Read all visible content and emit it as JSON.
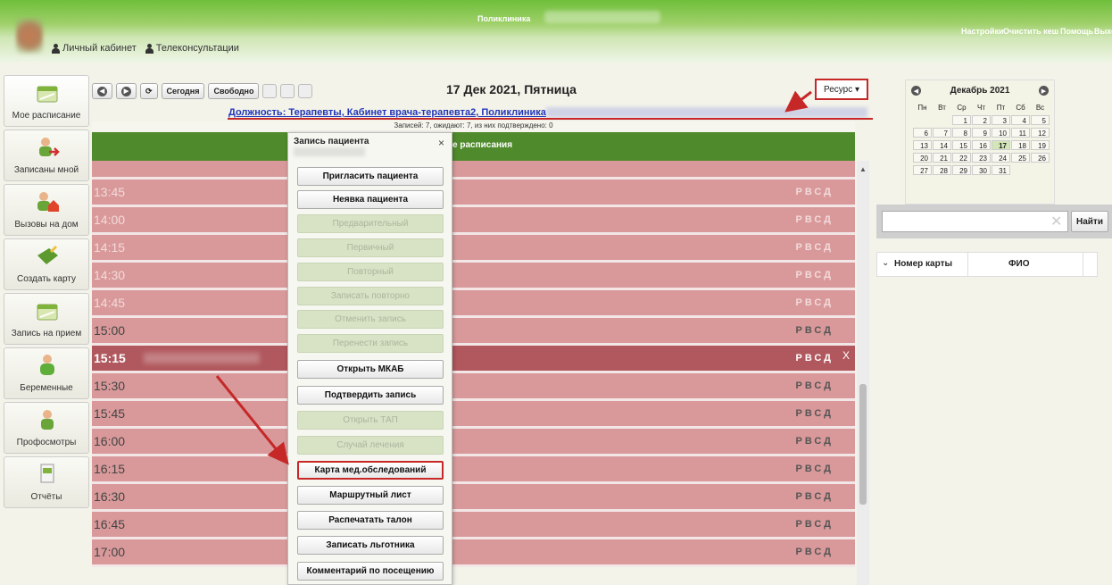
{
  "header": {
    "app_title": "Поликлиника",
    "top_links": [
      "Настройки",
      "Очистить кеш",
      "Помощь",
      "Выхо"
    ],
    "nav": [
      "Личный кабинет",
      "Телеконсультации"
    ]
  },
  "sidebar": {
    "items": [
      {
        "label": "Мое расписание",
        "icon": "calendar-icon"
      },
      {
        "label": "Записаны мной",
        "icon": "person-arrow-icon"
      },
      {
        "label": "Вызовы на дом",
        "icon": "person-house-icon"
      },
      {
        "label": "Создать карту",
        "icon": "book-pen-icon"
      },
      {
        "label": "Запись на прием",
        "icon": "calendar-icon"
      },
      {
        "label": "Беременные",
        "icon": "pregnant-icon"
      },
      {
        "label": "Профосмотры",
        "icon": "person-icon"
      },
      {
        "label": "Отчёты",
        "icon": "report-icon"
      }
    ]
  },
  "toolbar": {
    "today": "Сегодня",
    "free": "Свободно",
    "date_title": "17 Дек 2021, Пятница",
    "resource": "Ресурс ▾"
  },
  "schedule": {
    "position_link": "Должность: Терапевты, Кабинет врача-терапевта2, Поликлиника",
    "stats": "Записей: 7, ожидают: 7, из них подтверждено: 0",
    "header_text": "е расписания",
    "slots": [
      {
        "time": "13:45",
        "flags": "РВСД",
        "style": "faded"
      },
      {
        "time": "14:00",
        "flags": "РВСД",
        "style": "faded"
      },
      {
        "time": "14:15",
        "flags": "РВСД",
        "style": "faded"
      },
      {
        "time": "14:30",
        "flags": "РВСД",
        "style": "faded"
      },
      {
        "time": "14:45",
        "flags": "РВСД",
        "style": "faded"
      },
      {
        "time": "15:00",
        "flags": "РВСД",
        "style": "strong"
      },
      {
        "time": "15:15",
        "flags": "РВСД",
        "style": "selected"
      },
      {
        "time": "15:30",
        "flags": "РВСД",
        "style": "strong"
      },
      {
        "time": "15:45",
        "flags": "РВСД",
        "style": "strong"
      },
      {
        "time": "16:00",
        "flags": "РВСД",
        "style": "strong"
      },
      {
        "time": "16:15",
        "flags": "РВСД",
        "style": "strong"
      },
      {
        "time": "16:30",
        "flags": "РВСД",
        "style": "strong"
      },
      {
        "time": "16:45",
        "flags": "РВСД",
        "style": "strong"
      },
      {
        "time": "17:00",
        "flags": "РВСД",
        "style": "strong"
      }
    ],
    "selected_close": "X"
  },
  "popup": {
    "title": "Запись пациента",
    "close": "×",
    "buttons": [
      {
        "label": "Пригласить пациента",
        "enabled": true
      },
      {
        "label": "Неявка пациента",
        "enabled": true
      },
      {
        "label": "Предварительный",
        "enabled": false
      },
      {
        "label": "Первичный",
        "enabled": false
      },
      {
        "label": "Повторный",
        "enabled": false
      },
      {
        "label": "Записать повторно",
        "enabled": false
      },
      {
        "label": "Отменить запись",
        "enabled": false
      },
      {
        "label": "Перенести запись",
        "enabled": false
      },
      {
        "label": "Открыть МКАБ",
        "enabled": true
      },
      {
        "label": "Подтвердить запись",
        "enabled": true
      },
      {
        "label": "Открыть ТАП",
        "enabled": false
      },
      {
        "label": "Случай лечения",
        "enabled": false
      },
      {
        "label": "Карта мед.обследований",
        "enabled": true,
        "highlight": true
      },
      {
        "label": "Маршрутный лист",
        "enabled": true
      },
      {
        "label": "Распечатать талон",
        "enabled": true
      },
      {
        "label": "Записать льготника",
        "enabled": true
      },
      {
        "label": "Комментарий по посещению",
        "enabled": true
      }
    ]
  },
  "calendar": {
    "title": "Декабрь 2021",
    "weekdays": [
      "Пн",
      "Вт",
      "Ср",
      "Чт",
      "Пт",
      "Сб",
      "Вс"
    ],
    "weeks": [
      [
        "",
        "",
        "1",
        "2",
        "3",
        "4",
        "5"
      ],
      [
        "6",
        "7",
        "8",
        "9",
        "10",
        "11",
        "12"
      ],
      [
        "13",
        "14",
        "15",
        "16",
        "17",
        "18",
        "19"
      ],
      [
        "20",
        "21",
        "22",
        "23",
        "24",
        "25",
        "26"
      ],
      [
        "27",
        "28",
        "29",
        "30",
        "31",
        "",
        ""
      ]
    ],
    "selected_day": "17"
  },
  "search": {
    "placeholder": "",
    "button": "Найти"
  },
  "patients_table": {
    "columns": [
      "Номер карты",
      "ФИО"
    ]
  },
  "colors": {
    "header_green": "#6fbf3a",
    "schedule_green": "#4f8a2c",
    "slot_pink": "#d9999a",
    "slot_selected": "#b0585d",
    "highlight_red": "#c62828"
  }
}
